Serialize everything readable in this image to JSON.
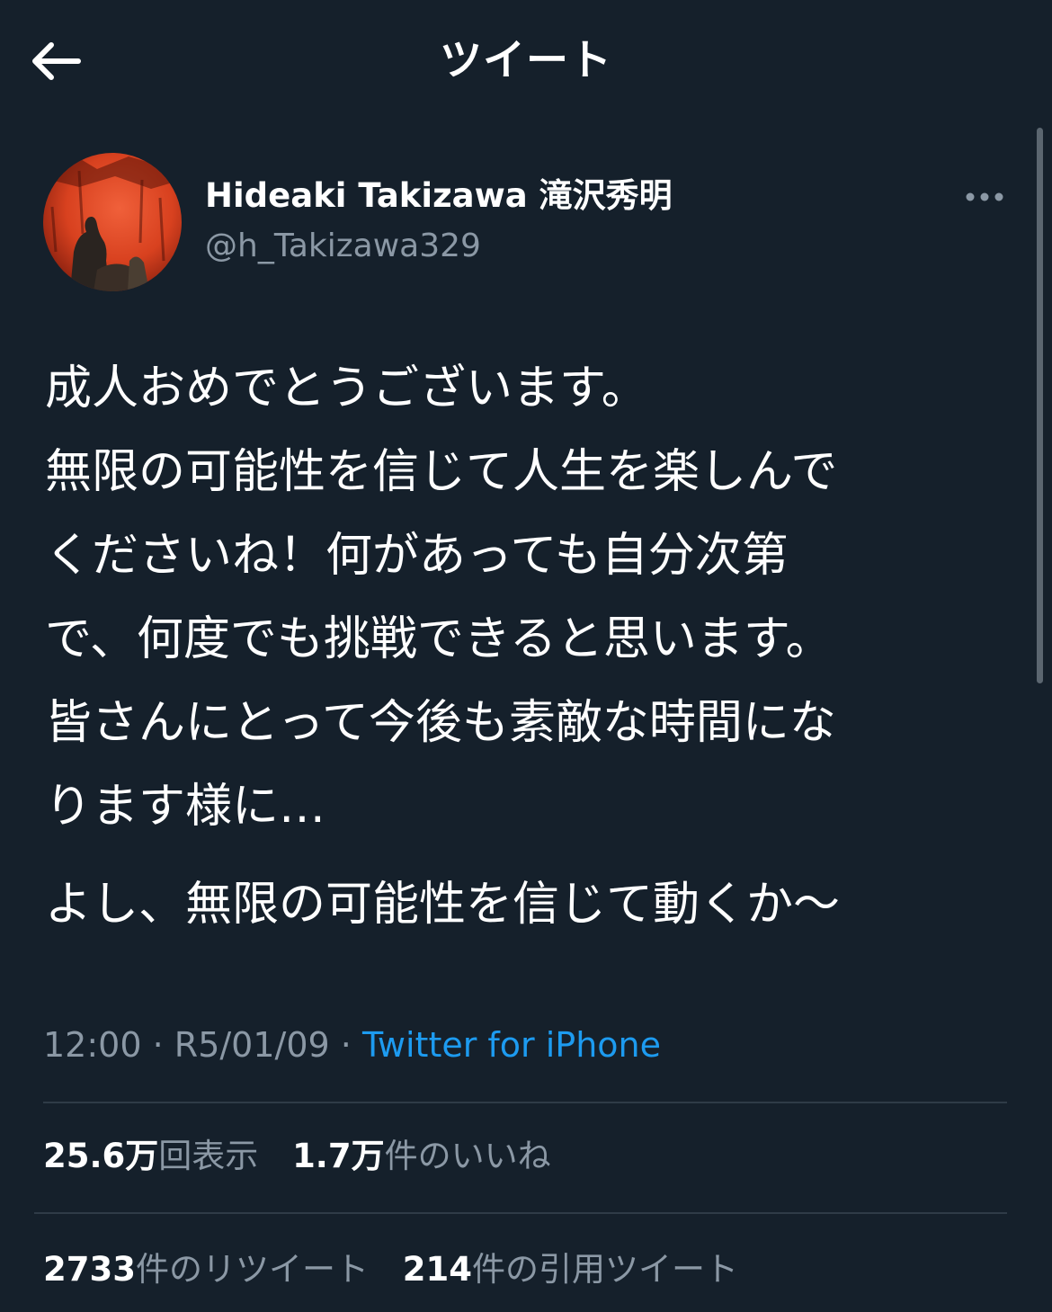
{
  "header": {
    "title": "ツイート",
    "back_icon": "back-arrow-icon"
  },
  "author": {
    "display_name": "Hideaki Takizawa 滝沢秀明",
    "handle": "@h_Takizawa329",
    "more_icon": "more-options-icon"
  },
  "tweet": {
    "lines": [
      "成人おめでとうございます。",
      "無限の可能性を信じて人生を楽しんで",
      "くださいね！何があっても自分次第",
      "で、何度でも挑戦できると思います。",
      "皆さんにとって今後も素敵な時間にな",
      "ります様に…"
    ],
    "second_paragraph": "よし、無限の可能性を信じて動くか〜"
  },
  "meta": {
    "time": "12:00",
    "separator": "·",
    "date": "R5/01/09",
    "source": "Twitter for iPhone"
  },
  "stats": {
    "views_num": "25.6万",
    "views_label": "回表示",
    "likes_num": "1.7万",
    "likes_label": "件のいいね",
    "retweets_num": "2733",
    "retweets_label": "件のリツイート",
    "quotes_num": "214",
    "quotes_label": "件の引用ツイート"
  },
  "colors": {
    "background": "#15202b",
    "text_primary": "#ffffff",
    "text_secondary": "#8b98a5",
    "link": "#1d9bf0",
    "divider": "#2f3b47"
  }
}
